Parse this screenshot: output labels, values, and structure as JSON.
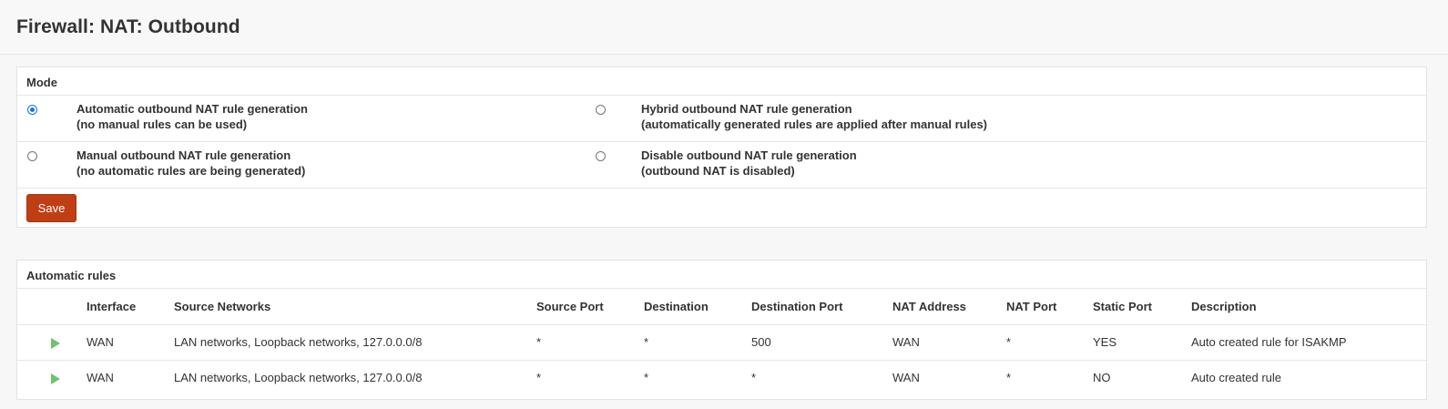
{
  "page": {
    "title": "Firewall: NAT: Outbound"
  },
  "mode": {
    "heading": "Mode",
    "options": [
      {
        "label": "Automatic outbound NAT rule generation",
        "sub": "(no manual rules can be used)",
        "checked": true
      },
      {
        "label": "Hybrid outbound NAT rule generation",
        "sub": "(automatically generated rules are applied after manual rules)",
        "checked": false
      },
      {
        "label": "Manual outbound NAT rule generation",
        "sub": "(no automatic rules are being generated)",
        "checked": false
      },
      {
        "label": "Disable outbound NAT rule generation",
        "sub": "(outbound NAT is disabled)",
        "checked": false
      }
    ],
    "save_label": "Save"
  },
  "rules": {
    "heading": "Automatic rules",
    "columns": [
      "Interface",
      "Source Networks",
      "Source Port",
      "Destination",
      "Destination Port",
      "NAT Address",
      "NAT Port",
      "Static Port",
      "Description"
    ],
    "rows": [
      {
        "status_icon": "play-icon",
        "status_color": "#6ec46a",
        "cells": [
          "WAN",
          "LAN networks, Loopback networks, 127.0.0.0/8",
          "*",
          "*",
          "500",
          "WAN",
          "*",
          "YES",
          "Auto created rule for ISAKMP"
        ]
      },
      {
        "status_icon": "play-icon",
        "status_color": "#6ec46a",
        "cells": [
          "WAN",
          "LAN networks, Loopback networks, 127.0.0.0/8",
          "*",
          "*",
          "*",
          "WAN",
          "*",
          "NO",
          "Auto created rule"
        ]
      }
    ]
  },
  "colors": {
    "save_button": "#c03e14",
    "radio_checked": "#1a73e8",
    "status_icon": "#6ec46a"
  }
}
